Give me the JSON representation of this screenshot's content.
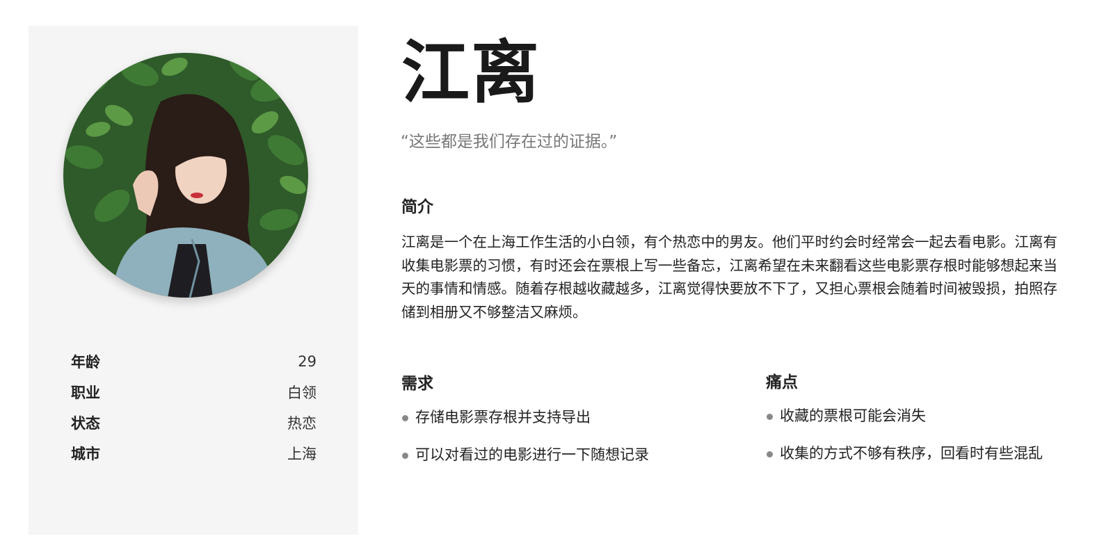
{
  "persona": {
    "name": "江离",
    "quote": "“这些都是我们存在过的证据。”",
    "details": [
      {
        "label": "年龄",
        "value": "29"
      },
      {
        "label": "职业",
        "value": "白领"
      },
      {
        "label": "状态",
        "value": "热恋"
      },
      {
        "label": "城市",
        "value": "上海"
      }
    ],
    "intro_title": "简介",
    "intro_text": "江离是一个在上海工作生活的小白领，有个热恋中的男友。他们平时约会时经常会一起去看电影。江离有收集电影票的习惯，有时还会在票根上写一些备忘，江离希望在未来翻看这些电影票存根时能够想起来当天的事情和情感。随着存根越收藏越多，江离觉得快要放不下了，又担心票根会随着时间被毁损，拍照存储到相册又不够整洁又麻烦。",
    "needs_title": "需求",
    "needs": [
      "存储电影票存根并支持导出",
      "可以对看过的电影进行一下随想记录"
    ],
    "pain_title": "痛点",
    "pains": [
      "收藏的票根可能会消失",
      "收集的方式不够有秩序，回看时有些混乱"
    ]
  }
}
